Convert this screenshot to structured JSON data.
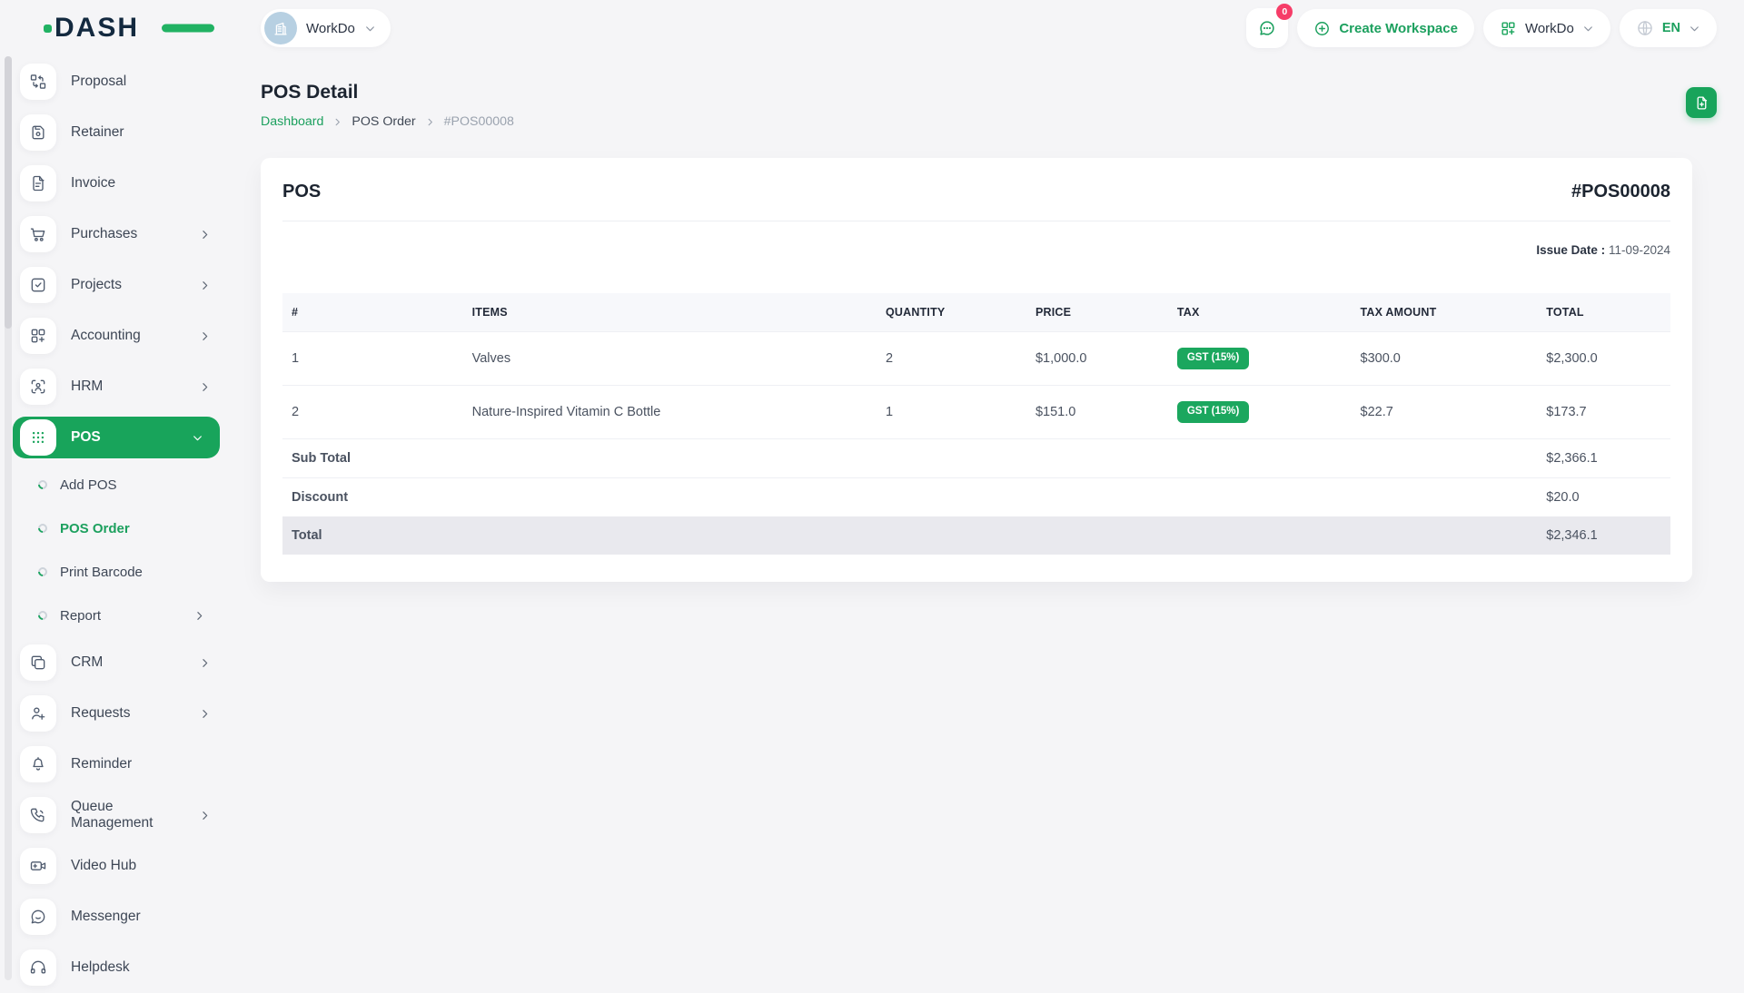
{
  "brand": {
    "logo_text": "DASH"
  },
  "header": {
    "workspace_name": "WorkDo",
    "chat_badge": "0",
    "create_workspace_label": "Create Workspace",
    "app_dropdown_label": "WorkDo",
    "language": "EN"
  },
  "sidebar": {
    "items": [
      {
        "label": "Proposal"
      },
      {
        "label": "Retainer"
      },
      {
        "label": "Invoice"
      },
      {
        "label": "Purchases"
      },
      {
        "label": "Projects"
      },
      {
        "label": "Accounting"
      },
      {
        "label": "HRM"
      },
      {
        "label": "POS"
      },
      {
        "label": "Add POS"
      },
      {
        "label": "POS Order"
      },
      {
        "label": "Print Barcode"
      },
      {
        "label": "Report"
      },
      {
        "label": "CRM"
      },
      {
        "label": "Requests"
      },
      {
        "label": "Reminder"
      },
      {
        "label": "Queue Management"
      },
      {
        "label": "Video Hub"
      },
      {
        "label": "Messenger"
      },
      {
        "label": "Helpdesk"
      }
    ]
  },
  "page": {
    "title": "POS Detail",
    "breadcrumb": [
      "Dashboard",
      "POS Order",
      "#POS00008"
    ]
  },
  "pos_card": {
    "title": "POS",
    "number": "#POS00008",
    "issue_date_label": "Issue Date :",
    "issue_date": "11-09-2024",
    "table": {
      "headers": [
        "#",
        "ITEMS",
        "QUANTITY",
        "PRICE",
        "TAX",
        "TAX AMOUNT",
        "TOTAL"
      ],
      "rows": [
        {
          "index": "1",
          "item": "Valves",
          "quantity": "2",
          "price": "$1,000.0",
          "tax": "GST (15%)",
          "tax_amount": "$300.0",
          "total": "$2,300.0"
        },
        {
          "index": "2",
          "item": "Nature-Inspired Vitamin C Bottle",
          "quantity": "1",
          "price": "$151.0",
          "tax": "GST (15%)",
          "tax_amount": "$22.7",
          "total": "$173.7"
        }
      ],
      "summary": [
        {
          "label": "Sub Total",
          "value": "$2,366.1"
        },
        {
          "label": "Discount",
          "value": "$20.0"
        },
        {
          "label": "Total",
          "value": "$2,346.1"
        }
      ]
    }
  },
  "icons": [
    "proposal-icon",
    "retainer-icon",
    "invoice-icon",
    "purchases-icon",
    "projects-icon",
    "accounting-icon",
    "hrm-icon",
    "pos-grid-icon",
    "crm-icon",
    "requests-icon",
    "reminder-icon",
    "queue-icon",
    "video-icon",
    "messenger-icon",
    "helpdesk-icon",
    "chat-icon",
    "plus-circle-icon",
    "grid-plus-icon",
    "globe-icon",
    "chevron-right-icon",
    "chevron-down-icon",
    "file-export-icon",
    "building-icon"
  ],
  "colors": {
    "primary_green": "#18a45b",
    "logo_green": "#21b263",
    "badge_pink": "#f63d68",
    "page_bg": "#f5f5f7",
    "card_bg": "#ffffff",
    "table_header_bg": "#f7f8fb",
    "total_row_bg": "#e9e9ee",
    "dark_text": "#1c2430"
  }
}
